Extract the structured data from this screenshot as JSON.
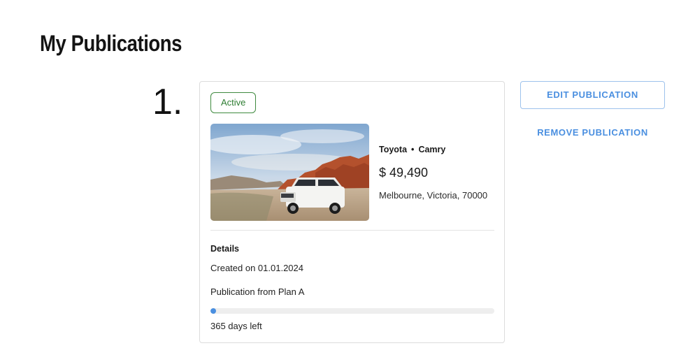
{
  "page": {
    "title": "My Publications"
  },
  "publication": {
    "index": "1.",
    "status": "Active",
    "make": "Toyota",
    "separator": "•",
    "model": "Camry",
    "price": "$ 49,490",
    "location": "Melbourne, Victoria, 70000",
    "details_heading": "Details",
    "created_on": "Created on 01.01.2024",
    "plan": "Publication from Plan A",
    "days_left": "365 days left",
    "progress_fraction": 0.01
  },
  "actions": {
    "edit_label": "EDIT PUBLICATION",
    "remove_label": "REMOVE PUBLICATION"
  },
  "colors": {
    "accent": "#4a8fe0",
    "active_green": "#2e7d32",
    "divider": "#e3e3e3"
  },
  "icons": {
    "image": "car-photo"
  }
}
